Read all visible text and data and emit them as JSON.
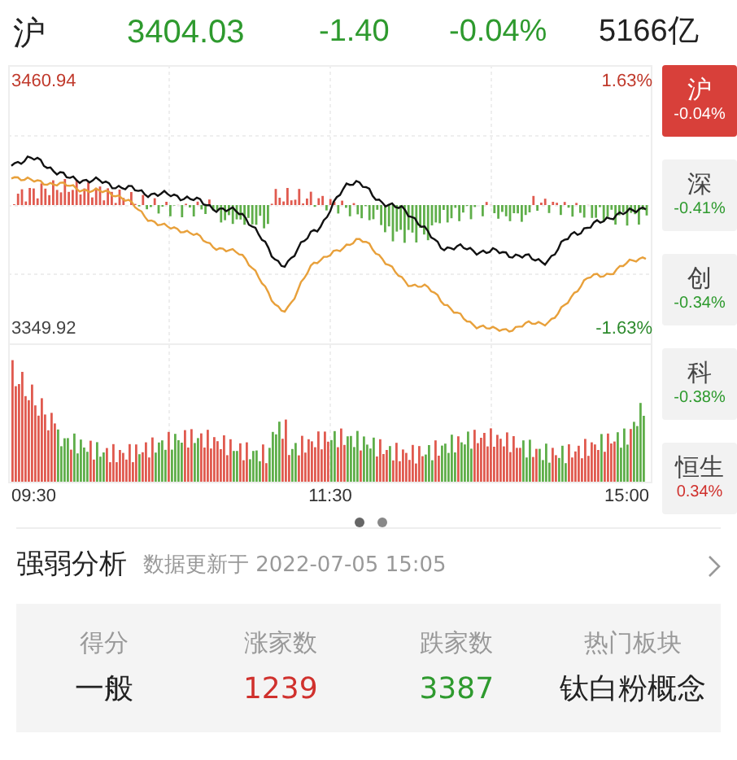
{
  "header": {
    "index": "沪",
    "price": "3404.03",
    "change": "-1.40",
    "change_pct": "-0.04%",
    "turnover": "5166亿",
    "color": "#2e9a2e"
  },
  "chart": {
    "price_high": "3460.94",
    "price_low": "3349.92",
    "pct_high": "1.63%",
    "pct_low": "-1.63%",
    "times": [
      "09:30",
      "11:30",
      "15:00"
    ]
  },
  "index_tabs": [
    {
      "name": "沪",
      "change": "-0.04%",
      "selected": true
    },
    {
      "name": "深",
      "change": "-0.41%",
      "color": "#2e9a2e",
      "selected": false
    },
    {
      "name": "创",
      "change": "-0.34%",
      "color": "#2e9a2e",
      "selected": false
    },
    {
      "name": "科",
      "change": "-0.38%",
      "color": "#2e9a2e",
      "selected": false
    },
    {
      "name": "恒生",
      "change": "0.34%",
      "color": "#d0312d",
      "selected": false
    }
  ],
  "analysis": {
    "title": "强弱分析",
    "updated": "数据更新于 2022-07-05 15:05",
    "stats": [
      {
        "label": "得分",
        "value": "一般",
        "color": "#222222"
      },
      {
        "label": "涨家数",
        "value": "1239",
        "color": "#d0312d"
      },
      {
        "label": "跌家数",
        "value": "3387",
        "color": "#2e9a2e"
      },
      {
        "label": "热门板块",
        "value": "钛白粉概念",
        "color": "#222222"
      }
    ]
  }
}
